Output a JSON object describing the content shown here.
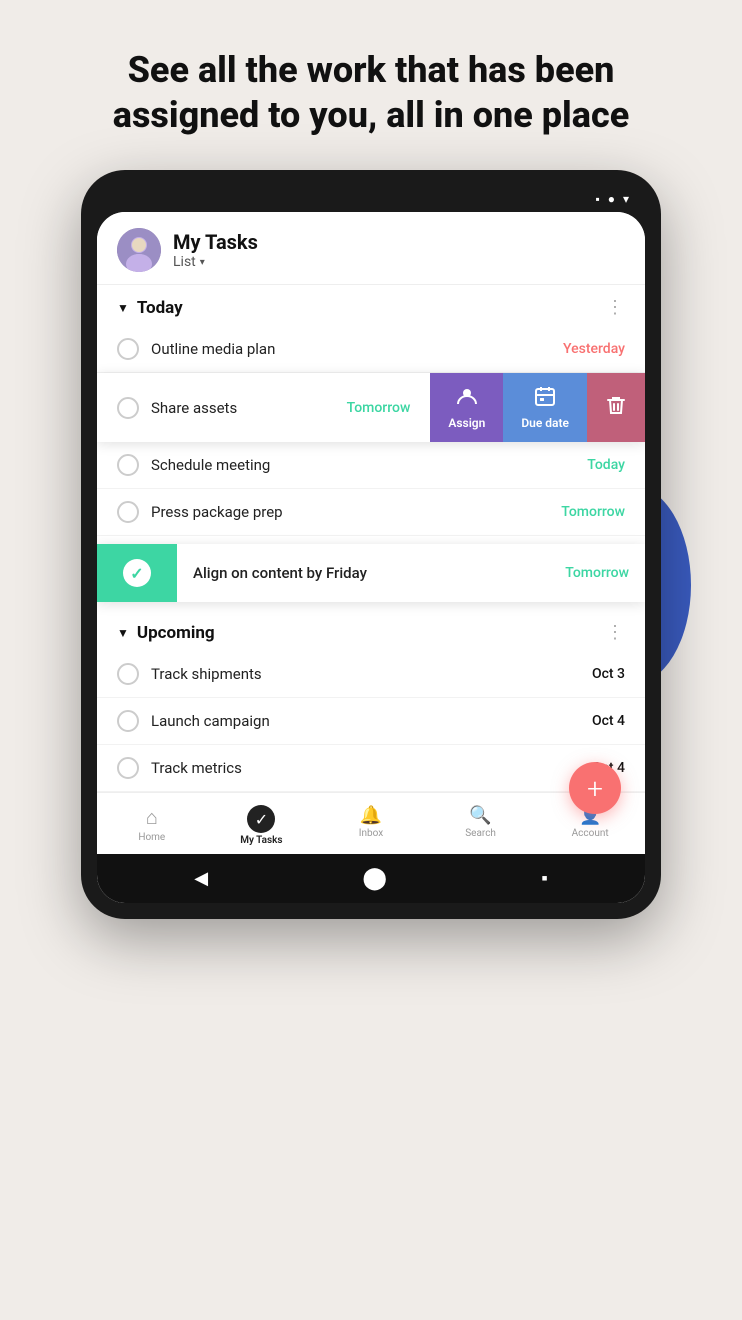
{
  "headline": {
    "line1": "See all the work that has been",
    "line2": "assigned to you, all in one place"
  },
  "status_bar": {
    "icons": [
      "▪",
      "●",
      "▾"
    ]
  },
  "app_header": {
    "title": "My Tasks",
    "subtitle": "List",
    "chevron": "▾"
  },
  "sections": {
    "today": {
      "label": "Today",
      "triangle": "▼"
    },
    "upcoming": {
      "label": "Upcoming",
      "triangle": "▼"
    }
  },
  "tasks_today": [
    {
      "name": "Outline media plan",
      "date": "Yesterday",
      "dateClass": "date-yesterday"
    },
    {
      "name": "Share assets",
      "date": "Tomorrow",
      "dateClass": "date-tomorrow",
      "swipe": true
    },
    {
      "name": "Schedule meeting",
      "date": "Today",
      "dateClass": "date-today"
    },
    {
      "name": "Press package prep",
      "date": "Tomorrow",
      "dateClass": "date-tomorrow"
    }
  ],
  "swipe_task": {
    "name": "Share assets",
    "date": "Tomorrow",
    "actions": [
      {
        "id": "assign",
        "label": "Assign",
        "icon": "👤",
        "bg": "#7c5cbf"
      },
      {
        "id": "due",
        "label": "Due date",
        "icon": "📅",
        "bg": "#5b8dd9"
      },
      {
        "id": "delete",
        "label": "",
        "icon": "🗑",
        "bg": "#c0607a"
      }
    ]
  },
  "swipe_complete_task": {
    "name": "Align on content by Friday",
    "date": "Tomorrow"
  },
  "tasks_upcoming": [
    {
      "name": "Track shipments",
      "date": "Oct 3",
      "dateClass": "date-oct"
    },
    {
      "name": "Launch campaign",
      "date": "Oct 4",
      "dateClass": "date-oct"
    },
    {
      "name": "Track metrics",
      "date": "Oct 4",
      "dateClass": "date-oct"
    }
  ],
  "bottom_nav": [
    {
      "id": "home",
      "label": "Home",
      "icon": "⌂",
      "active": false
    },
    {
      "id": "my-tasks",
      "label": "My Tasks",
      "icon": "✓",
      "active": true
    },
    {
      "id": "inbox",
      "label": "Inbox",
      "icon": "🔔",
      "active": false
    },
    {
      "id": "search",
      "label": "Search",
      "icon": "🔍",
      "active": false
    },
    {
      "id": "account",
      "label": "Account",
      "icon": "👤",
      "active": false
    }
  ],
  "fab": {
    "icon": "+"
  }
}
